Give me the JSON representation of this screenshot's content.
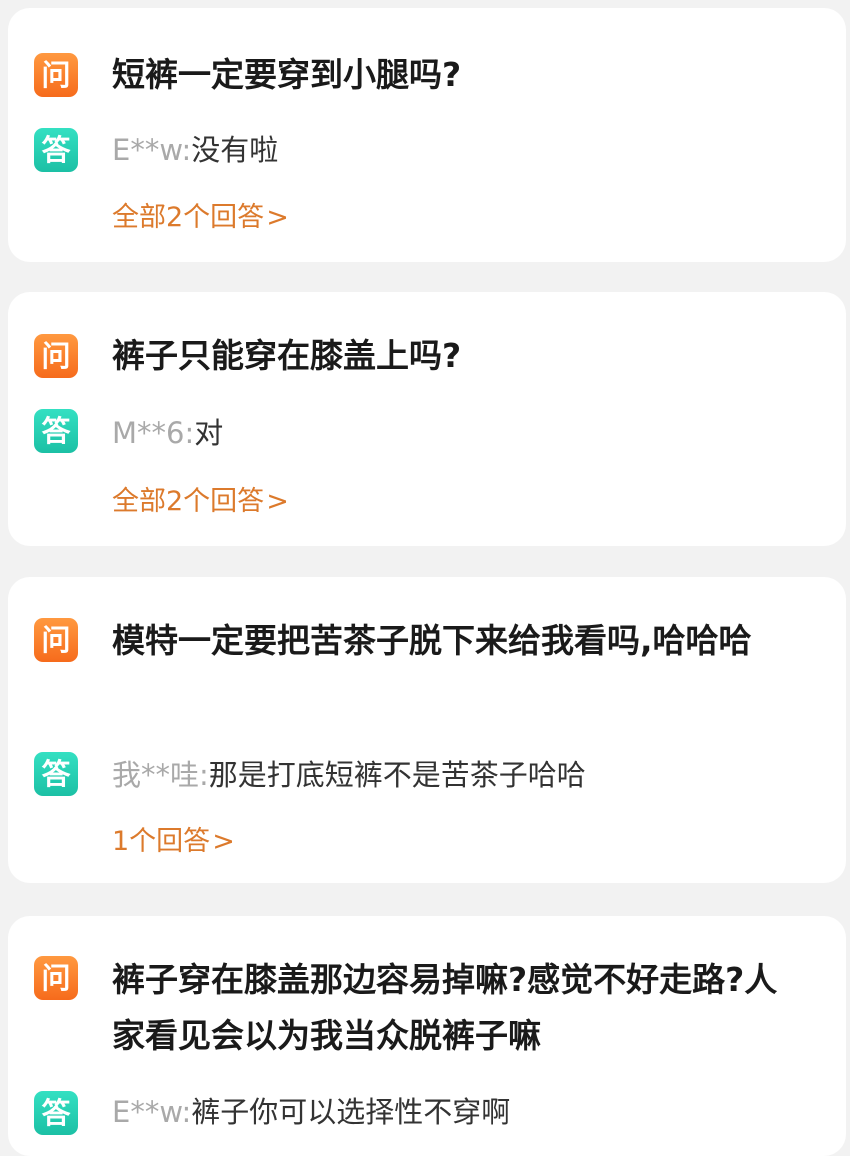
{
  "qa_items": [
    {
      "question_badge": "问",
      "question": "短裤一定要穿到小腿吗?",
      "answer_badge": "答",
      "answer_user": "E**w",
      "separator": ":",
      "answer": "没有啦",
      "more_label": "全部2个回答",
      "more_icon": ">"
    },
    {
      "question_badge": "问",
      "question": "裤子只能穿在膝盖上吗?",
      "answer_badge": "答",
      "answer_user": "M**6",
      "separator": ":",
      "answer": "对",
      "more_label": "全部2个回答",
      "more_icon": ">"
    },
    {
      "question_badge": "问",
      "question": "模特一定要把苦茶子脱下来给我看吗,哈哈哈",
      "answer_badge": "答",
      "answer_user": "我**哇",
      "separator": ":",
      "answer": "那是打底短裤不是苦茶子哈哈",
      "more_label": "1个回答",
      "more_icon": ">"
    },
    {
      "question_badge": "问",
      "question": "裤子穿在膝盖那边容易掉嘛?感觉不好走路?人家看见会以为我当众脱裤子嘛",
      "answer_badge": "答",
      "answer_user": "E**w",
      "separator": ":",
      "answer": "裤子你可以选择性不穿啊",
      "more_label": "",
      "more_icon": ""
    }
  ],
  "colors": {
    "question_badge": "#f66b1c",
    "answer_badge": "#1cc0a5",
    "more_link": "#dc7a2c",
    "background": "#f2f2f2",
    "card": "#ffffff"
  }
}
